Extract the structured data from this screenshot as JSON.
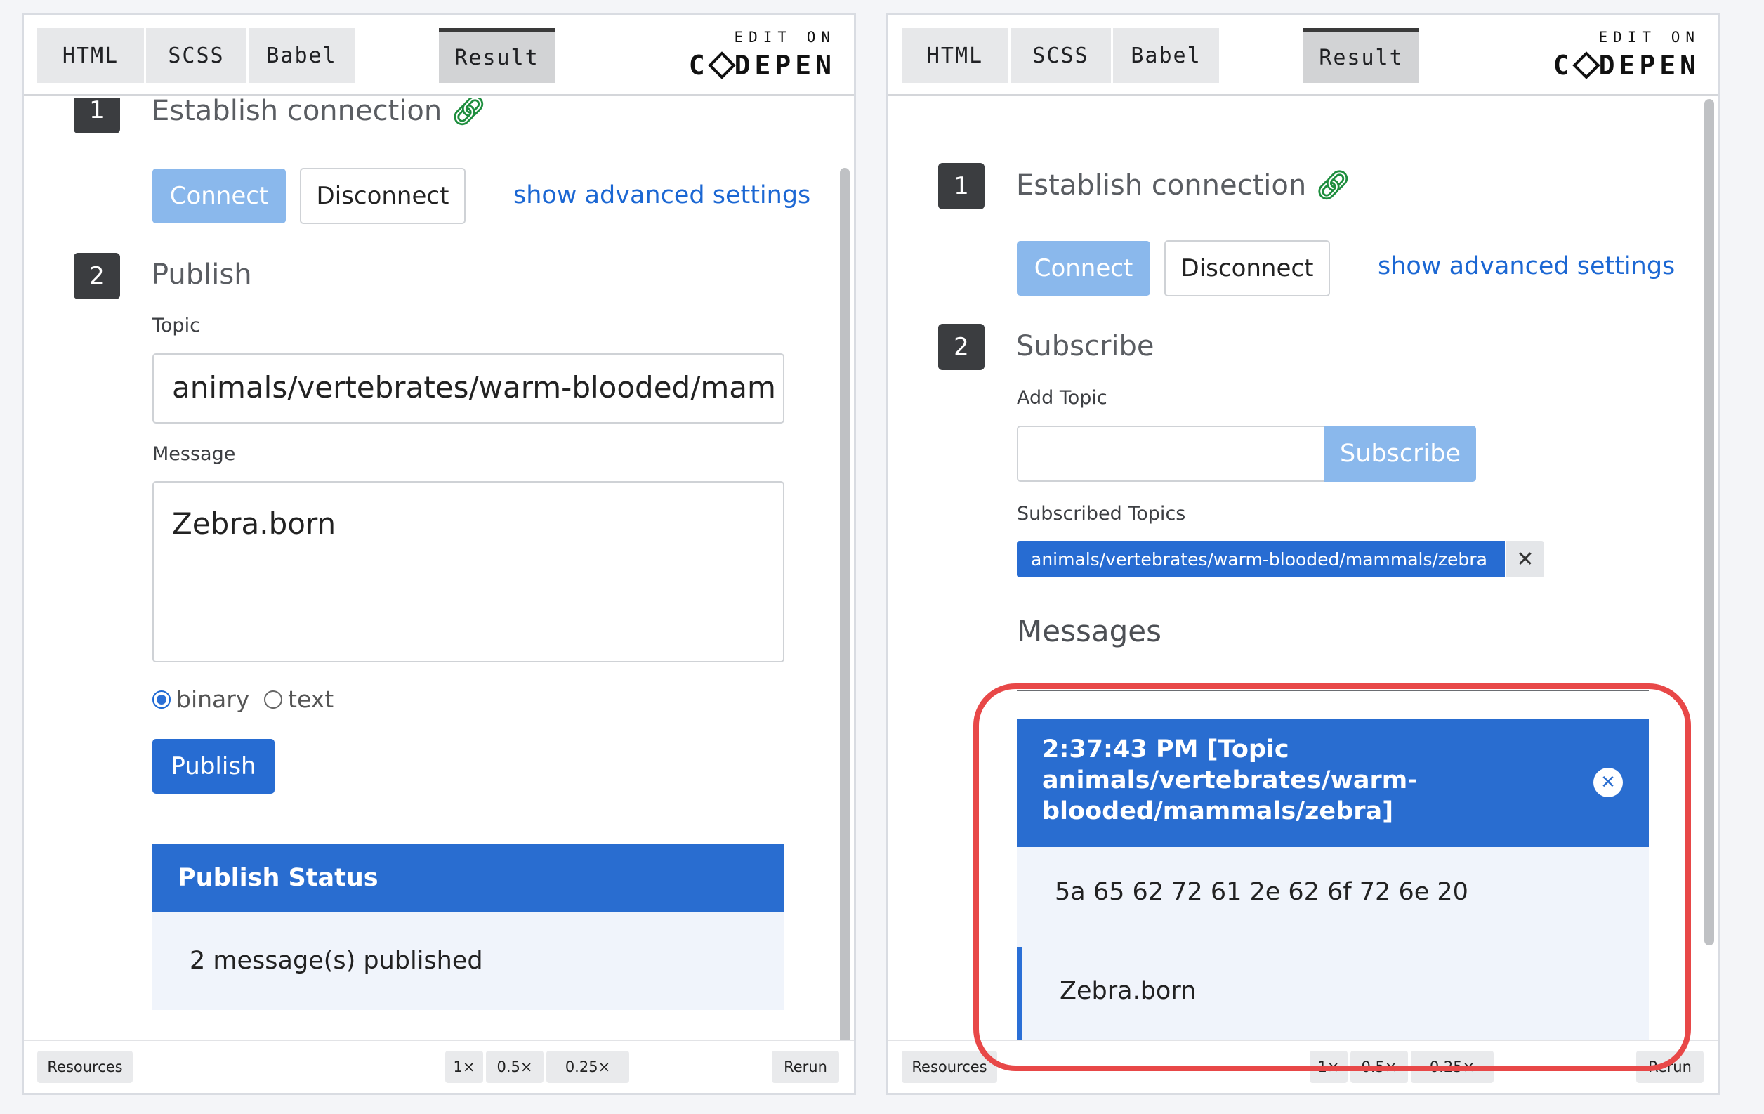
{
  "tabs": {
    "html": "HTML",
    "scss": "SCSS",
    "babel": "Babel",
    "result": "Result"
  },
  "codepen": {
    "edit_on": "EDIT ON",
    "brand_left": "C",
    "brand_right": "DEPEN"
  },
  "footer": {
    "resources": "Resources",
    "zoom_1": "1×",
    "zoom_05": "0.5×",
    "zoom_025": "0.25×",
    "rerun": "Rerun"
  },
  "left": {
    "step1": {
      "num": "1",
      "title": "Establish connection",
      "icon": "link-icon"
    },
    "connect": "Connect",
    "disconnect": "Disconnect",
    "advanced": "show advanced settings",
    "step2": {
      "num": "2",
      "title": "Publish"
    },
    "topic_label": "Topic",
    "topic_value": "animals/vertebrates/warm-blooded/mam",
    "message_label": "Message",
    "message_value": "Zebra.born",
    "radio_binary": "binary",
    "radio_text": "text",
    "publish": "Publish",
    "status_title": "Publish Status",
    "status_text": "2 message(s) published"
  },
  "right": {
    "step1": {
      "num": "1",
      "title": "Establish connection",
      "icon": "link-icon"
    },
    "connect": "Connect",
    "disconnect": "Disconnect",
    "advanced": "show advanced settings",
    "step2": {
      "num": "2",
      "title": "Subscribe"
    },
    "add_topic_label": "Add Topic",
    "add_topic_value": "",
    "subscribe": "Subscribe",
    "subscribed_label": "Subscribed Topics",
    "subscribed_topics": [
      "animals/vertebrates/warm-blooded/mammals/zebra"
    ],
    "messages_title": "Messages",
    "message": {
      "header_line1": "2:37:43 PM [Topic",
      "header_line2": "animals/vertebrates/warm-",
      "header_line3": "blooded/mammals/zebra]",
      "hex": "5a 65 62 72 61 2e 62 6f 72 6e 20",
      "text": "Zebra.born"
    }
  },
  "colors": {
    "accent": "#2a6fd6",
    "accent_light": "#8ab8ec",
    "highlight": "#e84848",
    "link_icon": "#1e8e3e"
  }
}
